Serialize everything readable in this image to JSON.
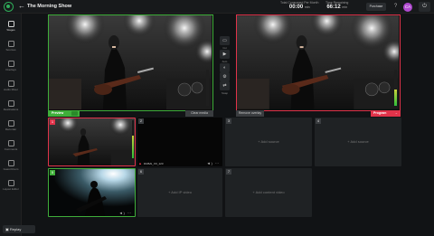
{
  "header": {
    "title": "The Morning Show",
    "stats": [
      {
        "label": "Total Consumed Per Month",
        "value": "00:00",
        "unit": "min"
      },
      {
        "label": "Time Remaining",
        "value": "66:12",
        "unit": "min"
      }
    ],
    "purchase_label": "Purchase",
    "avatar_initials": "CA"
  },
  "sidebar": {
    "items": [
      {
        "label": "Stages",
        "icon": "stage-icon",
        "active": true
      },
      {
        "label": "Sources",
        "icon": "sources-icon"
      },
      {
        "label": "Overlays",
        "icon": "overlays-icon"
      },
      {
        "label": "Audio Mixer",
        "icon": "audio-mixer-icon"
      },
      {
        "label": "Destinations",
        "icon": "destinations-icon"
      },
      {
        "label": "Recorder",
        "icon": "recorder-icon"
      },
      {
        "label": "Comments",
        "icon": "comments-icon"
      },
      {
        "label": "Guest Room",
        "icon": "guest-room-icon"
      },
      {
        "label": "Layout Editor",
        "icon": "layout-editor-icon"
      }
    ],
    "replay_label": "Replay"
  },
  "monitors": {
    "preview_label": "Preview",
    "program_label": "Program",
    "clear_media_label": "Clear media",
    "remove_overlay_label": "Remove overlay",
    "preview_level": 0.0,
    "program_level": 0.45
  },
  "transitions": {
    "items": [
      {
        "label": "Cut",
        "icon": "cut-icon"
      },
      {
        "label": "Auto",
        "icon": "auto-icon"
      },
      {
        "label": "Fade",
        "icon": "fade-icon"
      },
      {
        "label": "",
        "icon": "settings-icon"
      },
      {
        "label": "Swap",
        "icon": "swap-icon"
      }
    ]
  },
  "grid": {
    "cells": [
      {
        "num": "1",
        "type": "concert",
        "state": "program",
        "level": 0.6
      },
      {
        "num": "2",
        "type": "black",
        "name": "DUBAI_XX_123",
        "warning": true
      },
      {
        "num": "3",
        "type": "empty",
        "add_label": "+ Add source"
      },
      {
        "num": "4",
        "type": "empty",
        "add_label": "+ Add source"
      },
      {
        "num": "5",
        "type": "spotlight",
        "state": "preview"
      },
      {
        "num": "6",
        "type": "empty",
        "add_label": "+ Add IP video"
      },
      {
        "num": "7",
        "type": "empty",
        "add_label": "+ Add content video"
      }
    ]
  },
  "colors": {
    "preview": "#3fae3a",
    "program": "#e0334a",
    "accent": "#2fae5a"
  }
}
